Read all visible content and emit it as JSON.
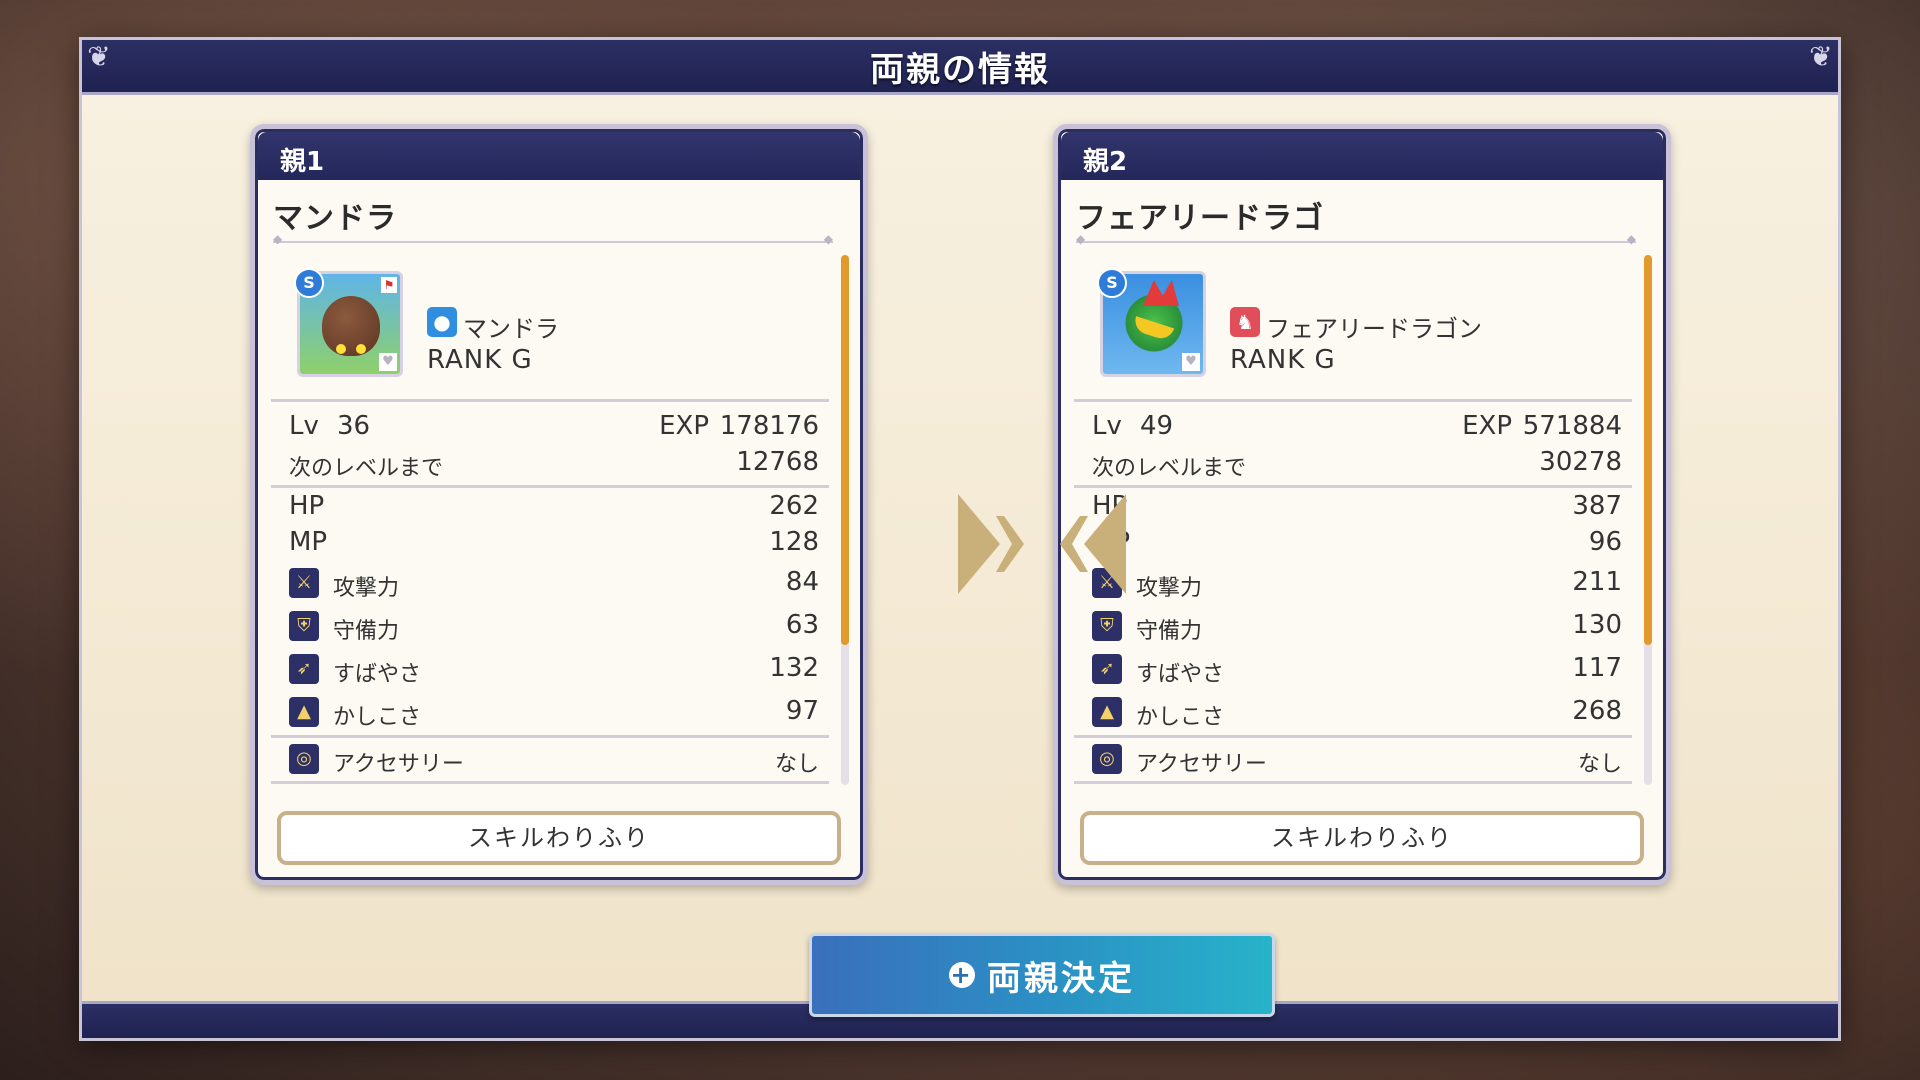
{
  "title": "両親の情報",
  "confirm_label": "両親決定",
  "parents": [
    {
      "header": "親1",
      "name": "マンドラ",
      "species": "マンドラ",
      "rank": "RANK G",
      "badge": "S",
      "lv_label": "Lv",
      "lv": "36",
      "exp_label": "EXP",
      "exp": "178176",
      "next_label": "次のレベルまで",
      "next": "12768",
      "hp_label": "HP",
      "hp": "262",
      "mp_label": "MP",
      "mp": "128",
      "atk_label": "攻撃力",
      "atk": "84",
      "def_label": "守備力",
      "def": "63",
      "agi_label": "すばやさ",
      "agi": "132",
      "wis_label": "かしこさ",
      "wis": "97",
      "acc_label": "アクセサリー",
      "acc": "なし",
      "skill_label": "スキルわりふり"
    },
    {
      "header": "親2",
      "name": "フェアリードラゴ",
      "species": "フェアリードラゴン",
      "rank": "RANK G",
      "badge": "S",
      "lv_label": "Lv",
      "lv": "49",
      "exp_label": "EXP",
      "exp": "571884",
      "next_label": "次のレベルまで",
      "next": "30278",
      "hp_label": "HP",
      "hp": "387",
      "mp_label": "MP",
      "mp": "96",
      "atk_label": "攻撃力",
      "atk": "211",
      "def_label": "守備力",
      "def": "130",
      "agi_label": "すばやさ",
      "agi": "117",
      "wis_label": "かしこさ",
      "wis": "268",
      "acc_label": "アクセサリー",
      "acc": "なし",
      "skill_label": "スキルわりふり"
    }
  ],
  "colors": {
    "header_navy": "#24275a",
    "confirm_blue": "#2b8fc4",
    "scroll_orange": "#e39a2c",
    "arrow_gold": "#c9b07a"
  }
}
